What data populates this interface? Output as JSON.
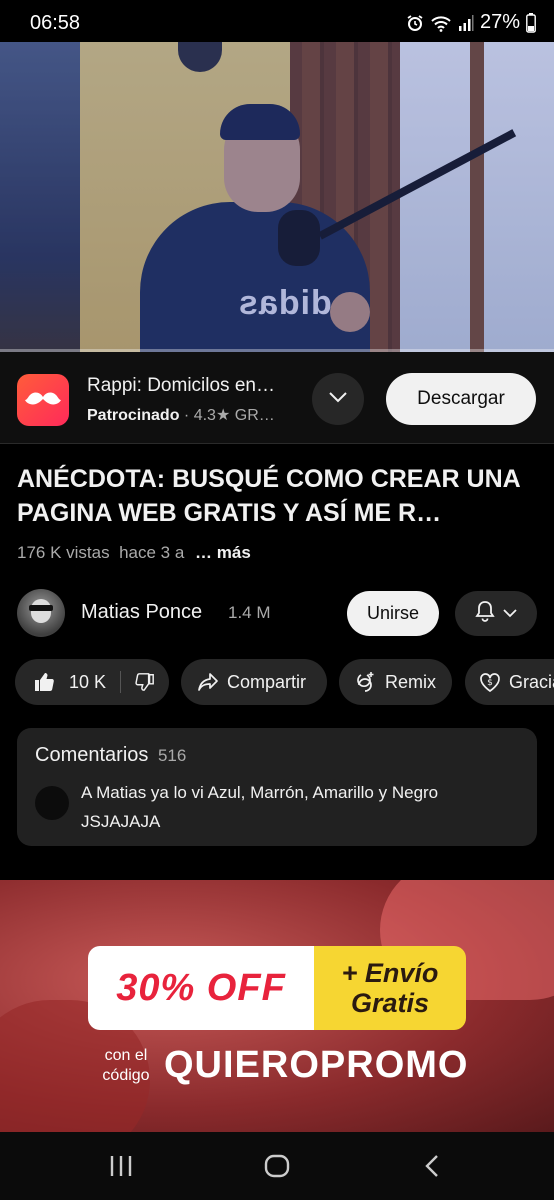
{
  "status_bar": {
    "time": "06:58",
    "battery": "27%",
    "icons": [
      "alarm-icon",
      "wifi-icon",
      "signal-icon",
      "battery-icon"
    ]
  },
  "video": {
    "shirt_logo_text": "adidas",
    "progress_fraction": 0.0
  },
  "sponsored": {
    "app_title": "Rappi: Domicilos en…",
    "sponsor_label": "Patrocinado",
    "separator": "·",
    "rating": "4.3★",
    "category": "GR…",
    "cta_label": "Descargar",
    "icon": "rappi-mustache-icon",
    "accent": "#ff4a3f"
  },
  "video_info": {
    "title": "ANÉCDOTA: BUSQUÉ COMO CREAR UNA PAGINA WEB GRATIS Y ASÍ ME R…",
    "views": "176 K vistas",
    "age": "hace 3 a",
    "more_label": "… más"
  },
  "channel": {
    "name": "Matias Ponce",
    "subscribers": "1.4 M",
    "join_label": "Unirse"
  },
  "actions": {
    "likes": "10 K",
    "share_label": "Compartir",
    "remix_label": "Remix",
    "thanks_label": "Gracias"
  },
  "comments": {
    "label": "Comentarios",
    "count": "516",
    "top_comment": "A Matias ya lo vi Azul, Marrón, Amarillo y Negro JSJAJAJA"
  },
  "banner": {
    "offer": "30% OFF",
    "shipping_line1": "+ Envío",
    "shipping_line2": "Gratis",
    "code_prefix": "con el código",
    "code": "QUIEROPROMO",
    "offer_color": "#e8233c",
    "shipping_bg": "#f6d632"
  }
}
